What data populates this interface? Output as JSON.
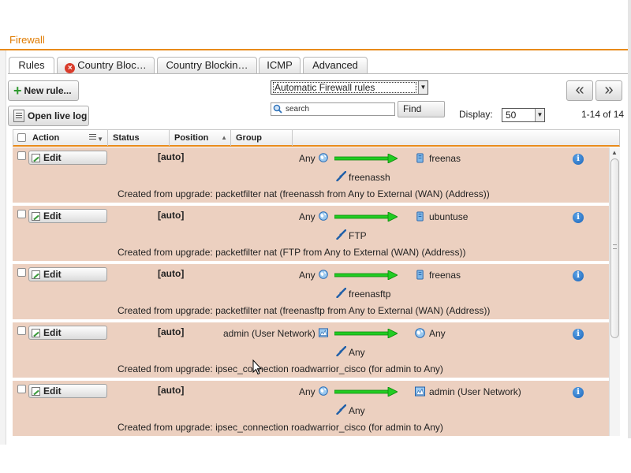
{
  "page": {
    "title": "Firewall"
  },
  "tabs": [
    {
      "label": "Rules"
    },
    {
      "label": "Country Bloc…"
    },
    {
      "label": "Country Blockin…"
    },
    {
      "label": "ICMP"
    },
    {
      "label": "Advanced"
    }
  ],
  "toolbar": {
    "new_rule_label": "New rule...",
    "open_log_label": "Open live log",
    "ruleset_selected": "Automatic Firewall rules",
    "search_placeholder": "search",
    "find_label": "Find",
    "prev_label": "«",
    "next_label": "»",
    "display_label": "Display:",
    "display_value": "50",
    "range_text": "1-14 of 14"
  },
  "table": {
    "columns": [
      "Action",
      "Status",
      "Position",
      "Group"
    ],
    "edit_label": "Edit",
    "rows": [
      {
        "status": "[auto]",
        "source": "Any",
        "source_icon": "globe-icon",
        "destination": "freenas",
        "destination_icon": "server-icon",
        "service": "freenassh",
        "description": "Created from upgrade: packetfilter nat (freenassh from Any to External (WAN) (Address))"
      },
      {
        "status": "[auto]",
        "source": "Any",
        "source_icon": "globe-icon",
        "destination": "ubuntuse",
        "destination_icon": "server-icon",
        "service": "FTP",
        "description": "Created from upgrade: packetfilter nat (FTP from Any to External (WAN) (Address))"
      },
      {
        "status": "[auto]",
        "source": "Any",
        "source_icon": "globe-icon",
        "destination": "freenas",
        "destination_icon": "server-icon",
        "service": "freenasftp",
        "description": "Created from upgrade: packetfilter nat (freenasftp from Any to External (WAN) (Address))"
      },
      {
        "status": "[auto]",
        "source": "admin (User Network)",
        "source_icon": "network-icon",
        "destination": "Any",
        "destination_icon": "globe-icon",
        "service": "Any",
        "description": "Created from upgrade: ipsec_connection roadwarrior_cisco (for admin to Any)"
      },
      {
        "status": "[auto]",
        "source": "Any",
        "source_icon": "globe-icon",
        "destination": "admin (User Network)",
        "destination_icon": "network-icon",
        "service": "Any",
        "description": "Created from upgrade: ipsec_connection roadwarrior_cisco (for admin to Any)"
      }
    ]
  },
  "colors": {
    "accent": "#e88a1a",
    "row_background": "#ecd0c0",
    "arrow_green": "#22cc22",
    "info_blue": "#1a63b8"
  }
}
